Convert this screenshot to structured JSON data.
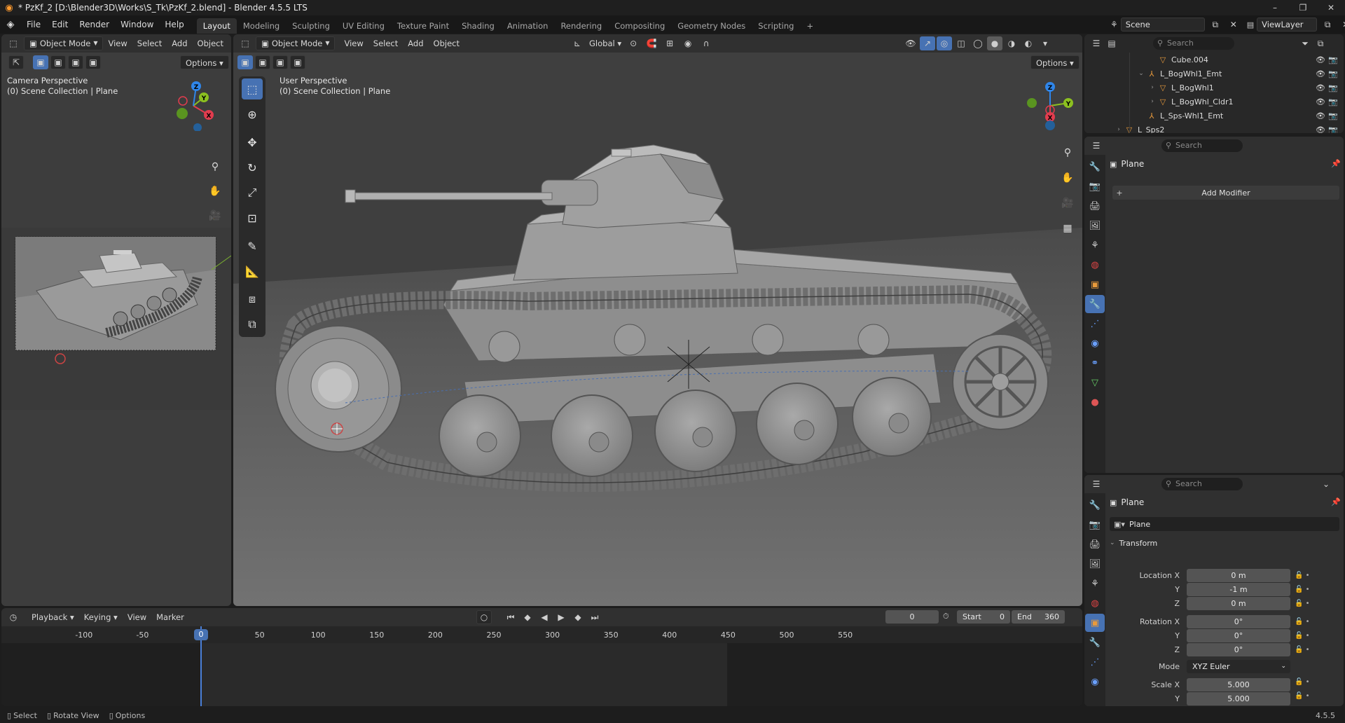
{
  "window": {
    "title": "* PzKf_2 [D:\\Blender3D\\Works\\S_Tk\\PzKf_2.blend] - Blender 4.5.5 LTS",
    "controls": [
      "–",
      "❐",
      "✕"
    ]
  },
  "menubar": {
    "items": [
      "File",
      "Edit",
      "Render",
      "Window",
      "Help"
    ],
    "workspaces": [
      "Layout",
      "Modeling",
      "Sculpting",
      "UV Editing",
      "Texture Paint",
      "Shading",
      "Animation",
      "Rendering",
      "Compositing",
      "Geometry Nodes",
      "Scripting"
    ],
    "active_workspace": "Layout",
    "add_tab": "+",
    "scene": "Scene",
    "view_layer": "ViewLayer"
  },
  "left_viewport": {
    "mode": "Object Mode",
    "menus": [
      "View",
      "Select",
      "Add",
      "Object"
    ],
    "options": "Options",
    "overlay_line1": "Camera Perspective",
    "overlay_line2": "(0) Scene Collection | Plane"
  },
  "main_viewport": {
    "mode": "Object Mode",
    "menus": [
      "View",
      "Select",
      "Add",
      "Object"
    ],
    "transform_orientation": "Global",
    "options": "Options",
    "overlay_line1": "User Perspective",
    "overlay_line2": "(0) Scene Collection | Plane"
  },
  "gizmo_labels": {
    "x": "X",
    "y": "Y",
    "z": "Z"
  },
  "outliner": {
    "search_placeholder": "Search",
    "rows": [
      {
        "label": "Cube.004",
        "indent": 5,
        "expand": "",
        "icon": "mesh-icon"
      },
      {
        "label": "L_BogWhl1_Emt",
        "indent": 4,
        "expand": "⌄",
        "icon": "empty-icon"
      },
      {
        "label": "L_BogWhl1",
        "indent": 5,
        "expand": "›",
        "icon": "mesh-icon"
      },
      {
        "label": "L_BogWhl_Cldr1",
        "indent": 5,
        "expand": "›",
        "icon": "mesh-icon"
      },
      {
        "label": "L_Sps-Whl1_Emt",
        "indent": 4,
        "expand": "",
        "icon": "empty-icon"
      },
      {
        "label": "L_Sps2",
        "indent": 2,
        "expand": "›",
        "icon": "mesh-icon"
      }
    ]
  },
  "modifier_panel": {
    "search_placeholder": "Search",
    "object_name": "Plane",
    "add_modifier": "Add Modifier"
  },
  "object_panel": {
    "search_placeholder": "Search",
    "object_name": "Plane",
    "datablock_name": "Plane",
    "section": "Transform",
    "location_label": "Location X",
    "location": [
      "0 m",
      "-1 m",
      "0 m"
    ],
    "rotation_label": "Rotation X",
    "rotation": [
      "0°",
      "0°",
      "0°"
    ],
    "mode_label": "Mode",
    "mode": "XYZ Euler",
    "scale_label": "Scale X",
    "scale": [
      "5.000",
      "5.000"
    ],
    "axis_y": "Y",
    "axis_z": "Z"
  },
  "timeline": {
    "menus": [
      "Playback",
      "Keying",
      "View",
      "Marker"
    ],
    "current_frame": "0",
    "start_label": "Start",
    "start": "0",
    "end_label": "End",
    "end": "360",
    "ticks": [
      "-100",
      "-50",
      "0",
      "50",
      "100",
      "150",
      "200",
      "250",
      "300",
      "350",
      "400",
      "450",
      "500",
      "550"
    ],
    "playhead": "0"
  },
  "statusbar": {
    "items": [
      "Select",
      "Rotate View",
      "Options"
    ],
    "version": "4.5.5"
  }
}
